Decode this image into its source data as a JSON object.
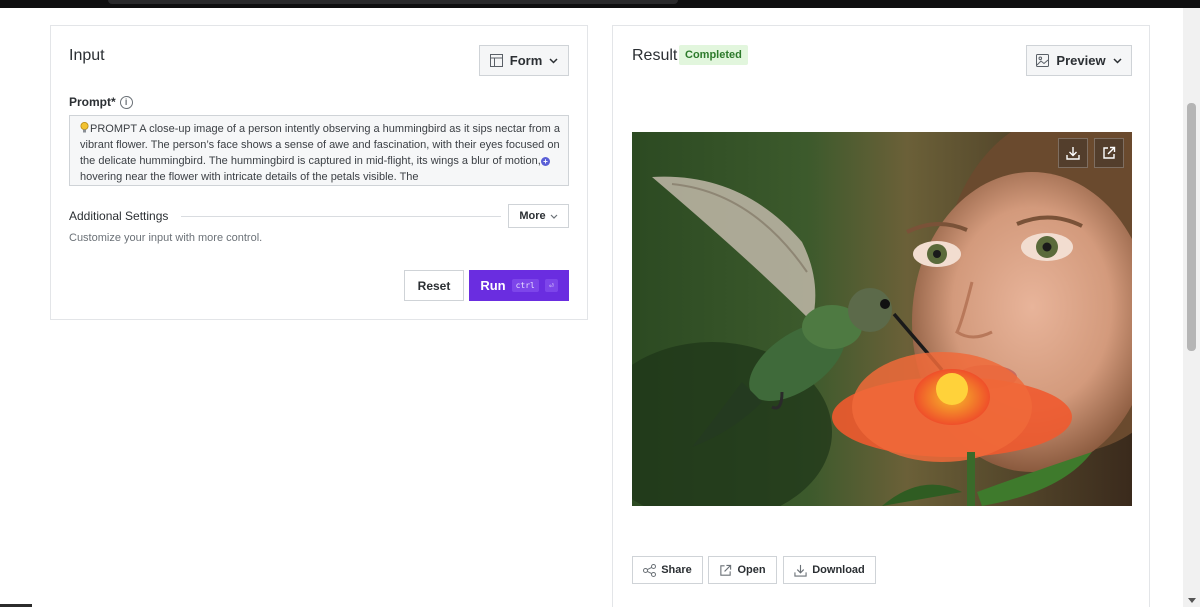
{
  "input_panel": {
    "title": "Input",
    "view_button_label": "Form",
    "prompt_label": "Prompt*",
    "prompt_text": "PROMPT A close-up image of a person intently observing a hummingbird as it sips nectar from a vibrant flower. The person’s face shows a sense of awe and fascination, with their eyes focused on the delicate hummingbird. The hummingbird is captured in mid-flight, its wings a blur of motion, hovering near the flower with intricate details of the petals visible. The",
    "settings_title": "Additional Settings",
    "more_label": "More",
    "settings_description": "Customize your input with more control.",
    "reset_label": "Reset",
    "run_label": "Run",
    "run_shortcut_ctrl": "ctrl",
    "run_shortcut_enter": "⏎"
  },
  "result_panel": {
    "title": "Result",
    "status": "Completed",
    "view_button_label": "Preview",
    "share_label": "Share",
    "open_label": "Open",
    "download_label": "Download"
  },
  "icons": {
    "form": "layout-icon",
    "preview": "image-icon",
    "prompt_info": "info-icon",
    "image_download": "download-icon",
    "image_open": "external-link-icon"
  },
  "colors": {
    "accent": "#6a2de0",
    "status_bg": "#e2f6dd",
    "status_text": "#2d7a2b"
  }
}
